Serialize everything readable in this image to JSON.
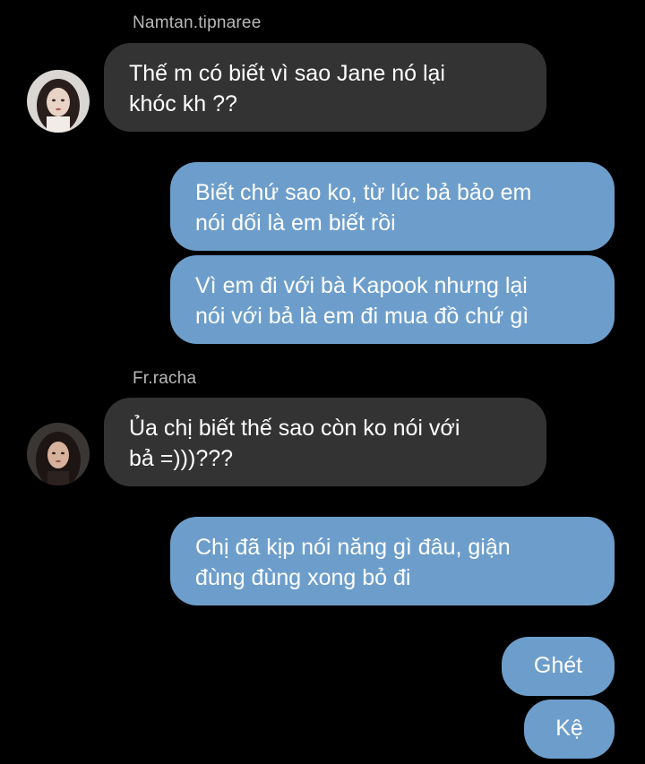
{
  "colors": {
    "background": "#000000",
    "incoming_bubble": "#333333",
    "outgoing_bubble": "#6d9ecb",
    "sender_name": "#b8b8b8"
  },
  "messages": [
    {
      "type": "incoming",
      "sender": "Namtan.tipnaree",
      "avatar": "avatar-namtan",
      "lines": [
        "Thế m có biết vì sao Jane nó lại",
        "khóc kh ??"
      ]
    },
    {
      "type": "outgoing",
      "lines": [
        "Biết chứ sao ko, từ lúc bả bảo em",
        "nói dối là em biết rồi"
      ]
    },
    {
      "type": "outgoing",
      "lines": [
        "Vì em đi với bà Kapook nhưng lại",
        "nói với bả là em đi mua đồ chứ gì"
      ]
    },
    {
      "type": "incoming",
      "sender": "Fr.racha",
      "avatar": "avatar-racha",
      "lines": [
        "Ủa chị biết thế sao còn ko nói với",
        "bả =)))???"
      ]
    },
    {
      "type": "outgoing",
      "lines": [
        "Chị đã kịp nói năng gì đâu, giận",
        "đùng đùng xong bỏ đi"
      ]
    },
    {
      "type": "outgoing",
      "lines": [
        "Ghét"
      ]
    },
    {
      "type": "outgoing",
      "lines": [
        "Kệ"
      ]
    }
  ]
}
